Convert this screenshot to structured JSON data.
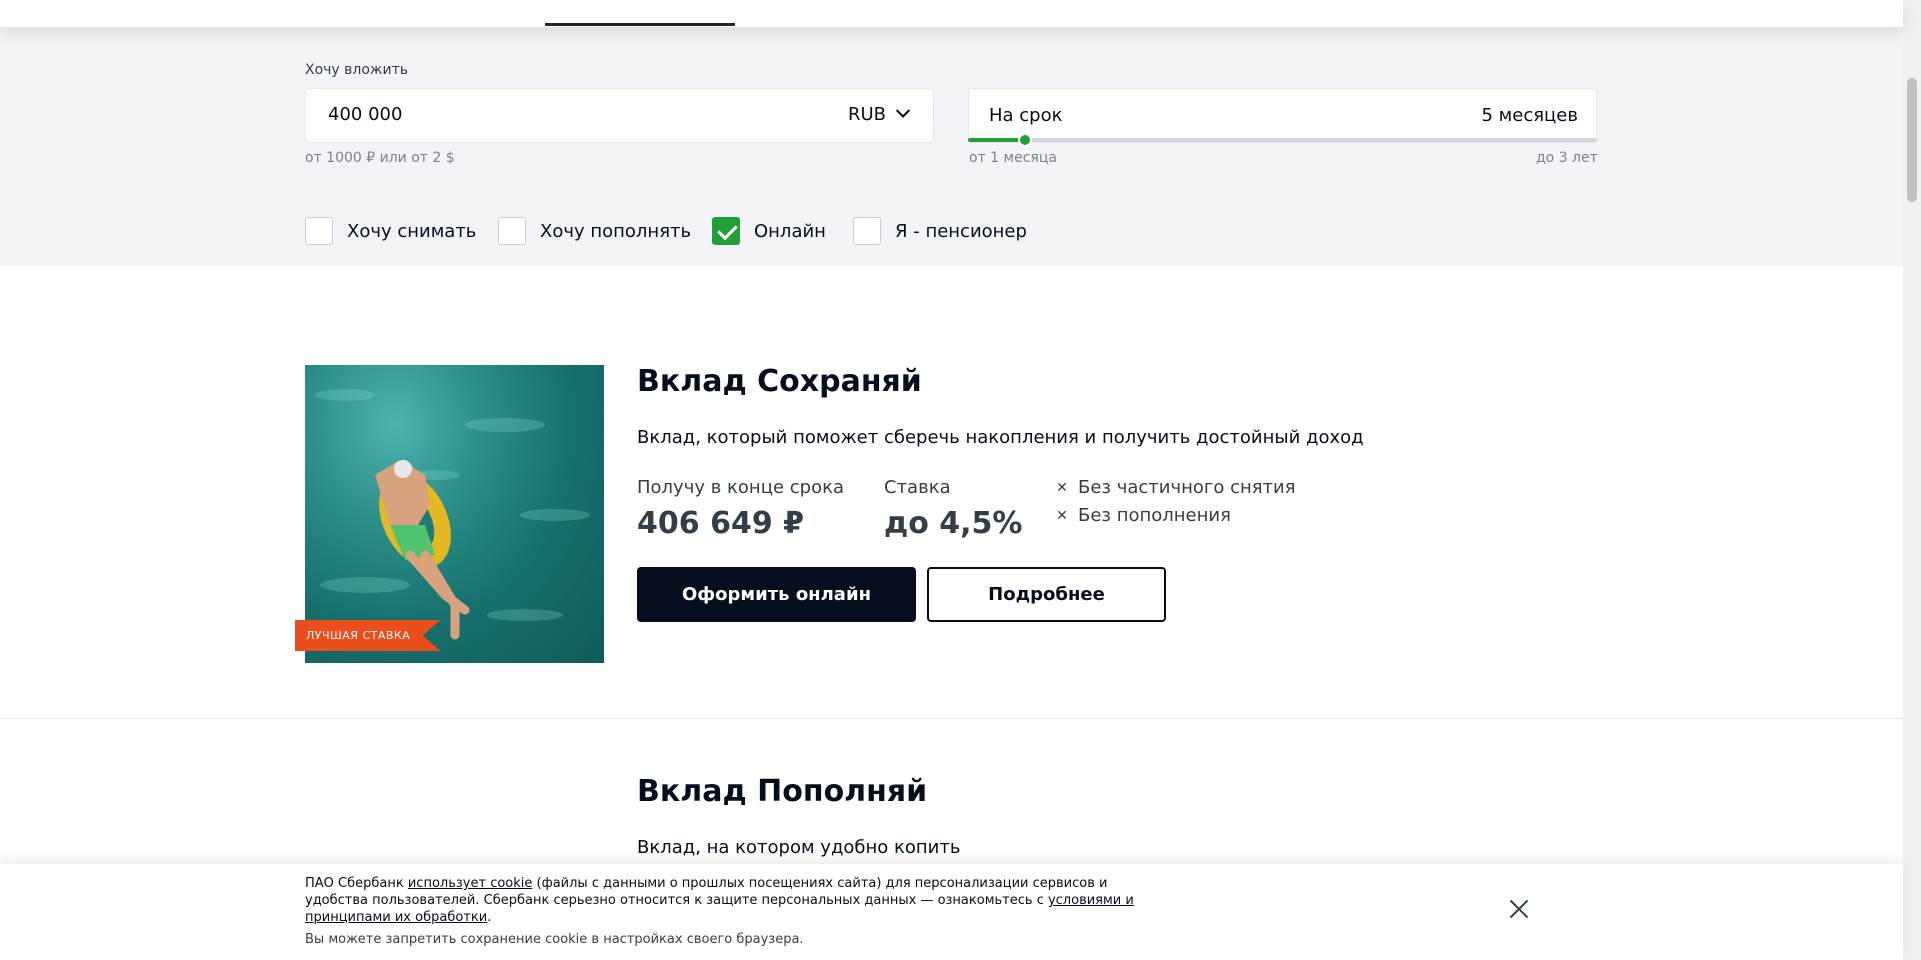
{
  "calculator": {
    "invest_label": "Хочу вложить",
    "amount_value": "400 000",
    "currency": "RUB",
    "amount_hint": "от 1000 ₽ или от 2 $",
    "term_label": "На срок",
    "term_value": "5 месяцев",
    "term_min": "от 1 месяца",
    "term_max": "до 3 лет",
    "slider_fraction": 0.09,
    "options": [
      {
        "label": "Хочу снимать",
        "checked": false
      },
      {
        "label": "Хочу пополнять",
        "checked": false
      },
      {
        "label": "Онлайн",
        "checked": true
      },
      {
        "label": "Я - пенсионер",
        "checked": false
      }
    ]
  },
  "products": [
    {
      "badge": "ЛУЧШАЯ СТАВКА",
      "title": "Вклад Сохраняй",
      "description": "Вклад, который поможет сберечь накопления и получить достойный доход",
      "income_label": "Получу в конце срока",
      "income_value": "406 649 ₽",
      "rate_label": "Ставка",
      "rate_value": "до 4,5%",
      "features": [
        "Без частичного снятия",
        "Без пополнения"
      ],
      "primary_button": "Оформить онлайн",
      "secondary_button": "Подробнее"
    },
    {
      "title": "Вклад Пополняй",
      "description": "Вклад, на котором удобно копить"
    }
  ],
  "cookie": {
    "text_1": "ПАО Сбербанк ",
    "link_1": "использует cookie",
    "text_2": " (файлы с данными о прошлых посещениях сайта) для персонализации сервисов и удобства пользователей. Сбербанк серьезно относится к защите персональных данных — ознакомьтесь с ",
    "link_2": "условиями и принципами их обработки",
    "text_3": ".",
    "note": "Вы можете запретить сохранение cookie в настройках своего браузера."
  },
  "colors": {
    "accent_green": "#21a038",
    "badge_orange": "#e94e1b",
    "primary_dark": "#040e1c",
    "panel_bg": "#f2f4f7"
  }
}
